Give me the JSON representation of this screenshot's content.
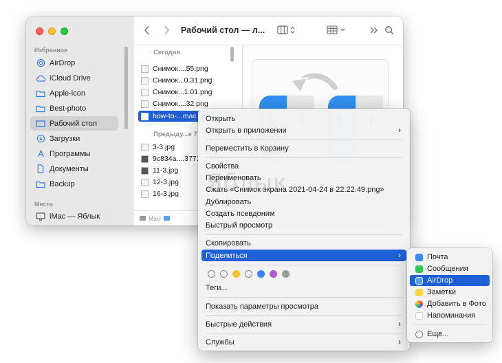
{
  "sidebar": {
    "favorites_header": "Избранное",
    "places_header": "Места",
    "items": [
      {
        "label": "AirDrop",
        "icon": "airdrop-icon"
      },
      {
        "label": "iCloud Drive",
        "icon": "cloud-icon"
      },
      {
        "label": "Apple-icon",
        "icon": "folder-icon"
      },
      {
        "label": "Best-photo",
        "icon": "folder-icon"
      },
      {
        "label": "Рабочий стол",
        "icon": "desktop-folder-icon"
      },
      {
        "label": "Загрузки",
        "icon": "downloads-icon"
      },
      {
        "label": "Программы",
        "icon": "applications-icon"
      },
      {
        "label": "Документы",
        "icon": "document-icon"
      },
      {
        "label": "Backup",
        "icon": "folder-icon"
      }
    ],
    "places": [
      {
        "label": "iMac — Яблык",
        "icon": "imac-icon"
      }
    ]
  },
  "toolbar": {
    "title": "Рабочий стол — л..."
  },
  "filelist": {
    "today_header": "Сегодня",
    "prev_header": "Предыду...е 7 д",
    "today_files": [
      "Снимок....55.png",
      "Снимок...0.31.png",
      "Снимок...1.01.png",
      "Снимок....32.png",
      "how-to-...mac"
    ],
    "prev_files": [
      "3-3.jpg",
      "9c834a....3771",
      "11-3.jpg",
      "12-3.jpg",
      "16-3.jpg"
    ],
    "pathbar": "Maci"
  },
  "context_menu": {
    "items": [
      {
        "label": "Открыть",
        "submenu": false
      },
      {
        "label": "Открыть в приложении",
        "submenu": true
      },
      {
        "label": "Переместить в Корзину",
        "submenu": false
      },
      {
        "label": "Свойства",
        "submenu": false
      },
      {
        "label": "Переименовать",
        "submenu": false
      },
      {
        "label": "Сжать «Снимок экрана 2021-04-24 в 22.22.49.png»",
        "submenu": false
      },
      {
        "label": "Дублировать",
        "submenu": false
      },
      {
        "label": "Создать псевдоним",
        "submenu": false
      },
      {
        "label": "Быстрый просмотр",
        "submenu": false
      },
      {
        "label": "Скопировать",
        "submenu": false
      },
      {
        "label": "Поделиться",
        "submenu": true
      },
      {
        "label": "Теги...",
        "submenu": false
      },
      {
        "label": "Показать параметры просмотра",
        "submenu": false
      },
      {
        "label": "Быстрые действия",
        "submenu": true
      },
      {
        "label": "Службы",
        "submenu": true
      }
    ],
    "tag_colors": [
      "#ffffff",
      "#ffffff",
      "#f4c430",
      "#ffffff",
      "#3b82f6",
      "#b05cd6",
      "#9a9a9a"
    ]
  },
  "share_submenu": {
    "items": [
      {
        "label": "Почта",
        "color": "#3d8bf2"
      },
      {
        "label": "Сообщения",
        "color": "#34c759"
      },
      {
        "label": "AirDrop",
        "color": "#4aa3f5"
      },
      {
        "label": "Заметки",
        "color": "#f7d54a"
      },
      {
        "label": "Добавить в Фото",
        "color": "#f08a3c"
      },
      {
        "label": "Напоминания",
        "color": "#ffffff"
      },
      {
        "label": "Еще...",
        "color": "#ffffff"
      }
    ]
  },
  "watermark": "Яблык"
}
